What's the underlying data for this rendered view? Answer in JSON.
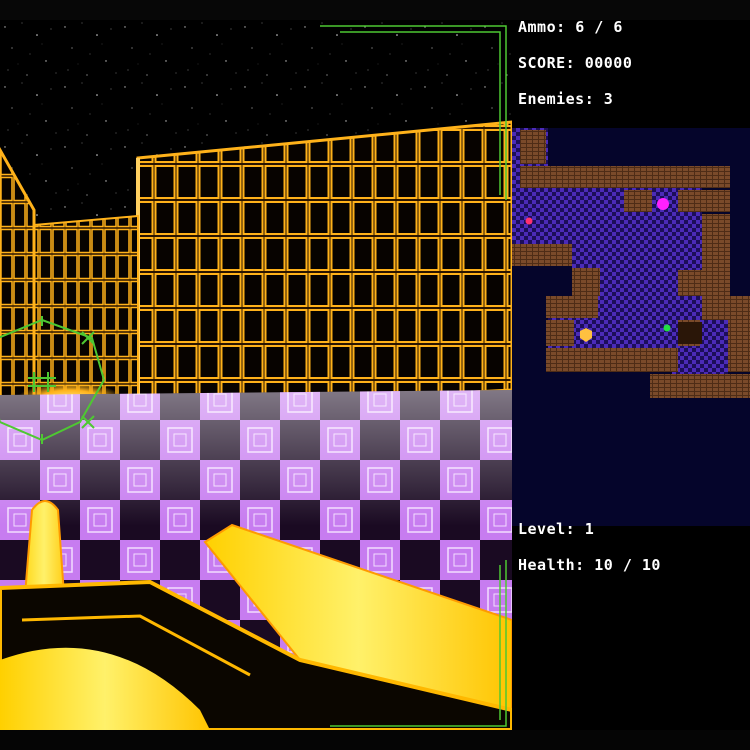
{
  "hud": {
    "ammo_label": "Ammo:",
    "ammo_current": "6",
    "ammo_max": "6",
    "score_label": "SCORE:",
    "score_value": "00000",
    "enemies_label": "Enemies:",
    "enemies_value": "3",
    "level_label": "Level:",
    "level_value": "1",
    "health_label": "Health:",
    "health_current": "10",
    "health_max": "10",
    "separator": "/"
  },
  "colors": {
    "wall_glow": "#ffb21a",
    "floor_grid": "#c77cf0",
    "weapon": "#ffe800",
    "crosshair": "#4ec832",
    "minimap_bg": "#05052b",
    "minimap_floor": "#4b2bb8",
    "minimap_wall": "#7a4a2a",
    "enemy_magenta": "#ff20ff",
    "enemy_red": "#ff3070",
    "enemy_green": "#22dd44",
    "player_marker": "#ffc040"
  },
  "icons": {
    "crosshair": "crosshair-icon",
    "player": "player-marker-icon",
    "enemy": "enemy-marker-icon"
  }
}
